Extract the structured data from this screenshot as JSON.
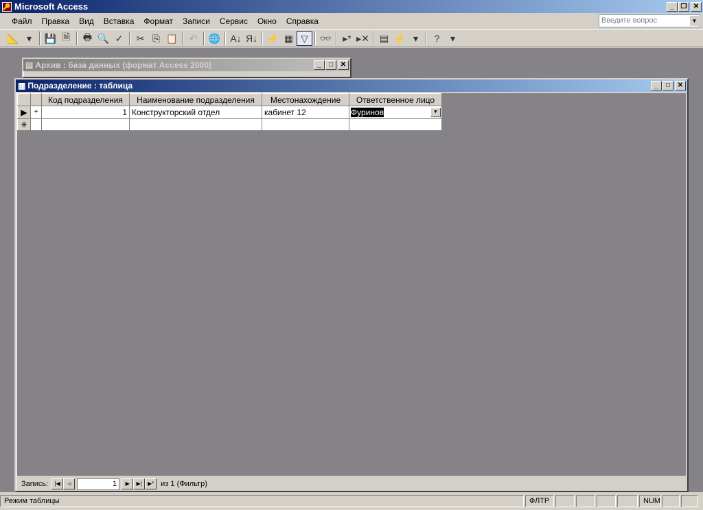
{
  "app": {
    "title": "Microsoft Access"
  },
  "menu": [
    "Файл",
    "Правка",
    "Вид",
    "Вставка",
    "Формат",
    "Записи",
    "Сервис",
    "Окно",
    "Справка"
  ],
  "ask_placeholder": "Введите вопрос",
  "toolbar": [
    {
      "icon": "view-design-icon",
      "g": "📐"
    },
    {
      "icon": "dropdown-icon",
      "g": "▾"
    },
    {
      "sep": true
    },
    {
      "icon": "save-icon",
      "g": "💾"
    },
    {
      "icon": "search-file-icon",
      "g": "🗎"
    },
    {
      "sep": true
    },
    {
      "icon": "print-icon",
      "g": "🖶"
    },
    {
      "icon": "print-preview-icon",
      "g": "🔍"
    },
    {
      "icon": "spelling-icon",
      "g": "✓"
    },
    {
      "sep": true
    },
    {
      "icon": "cut-icon",
      "g": "✂"
    },
    {
      "icon": "copy-icon",
      "g": "⎘"
    },
    {
      "icon": "paste-icon",
      "g": "📋",
      "dis": true
    },
    {
      "sep": true
    },
    {
      "icon": "undo-icon",
      "g": "↶",
      "dis": true
    },
    {
      "sep": true
    },
    {
      "icon": "hyperlink-icon",
      "g": "🌐",
      "dis": true
    },
    {
      "sep": true
    },
    {
      "icon": "sort-ascending-icon",
      "g": "A↓"
    },
    {
      "icon": "sort-descending-icon",
      "g": "Я↓"
    },
    {
      "sep": true
    },
    {
      "icon": "filter-by-selection-icon",
      "g": "⚡"
    },
    {
      "icon": "filter-by-form-icon",
      "g": "▦"
    },
    {
      "icon": "apply-filter-icon",
      "g": "▽",
      "on": true
    },
    {
      "sep": true
    },
    {
      "icon": "find-icon",
      "g": "👓"
    },
    {
      "sep": true
    },
    {
      "icon": "new-record-icon",
      "g": "▸*"
    },
    {
      "icon": "delete-record-icon",
      "g": "▸✕"
    },
    {
      "sep": true
    },
    {
      "icon": "database-window-icon",
      "g": "▤"
    },
    {
      "icon": "new-object-icon",
      "g": "⚡"
    },
    {
      "icon": "dropdown-icon",
      "g": "▾"
    },
    {
      "sep": true
    },
    {
      "icon": "help-icon",
      "g": "?"
    },
    {
      "icon": "toolbar-options-icon",
      "g": "▾"
    }
  ],
  "db_window": {
    "title": "Архив : база данных (формат Access 2000)"
  },
  "table_window": {
    "title": "Подразделение : таблица"
  },
  "columns": [
    "Код подразделения",
    "Наименование подразделения",
    "Местонахождение",
    "Ответственное лицо"
  ],
  "rows": [
    {
      "code": "1",
      "name": "Конструкторский отдел",
      "location": "кабинет 12",
      "person": "Фуринов"
    }
  ],
  "nav": {
    "label": "Запись:",
    "current": "1",
    "of": "из 1 (Фильтр)"
  },
  "status": {
    "mode": "Режим таблицы",
    "filter": "ФЛТР",
    "num": "NUM"
  }
}
